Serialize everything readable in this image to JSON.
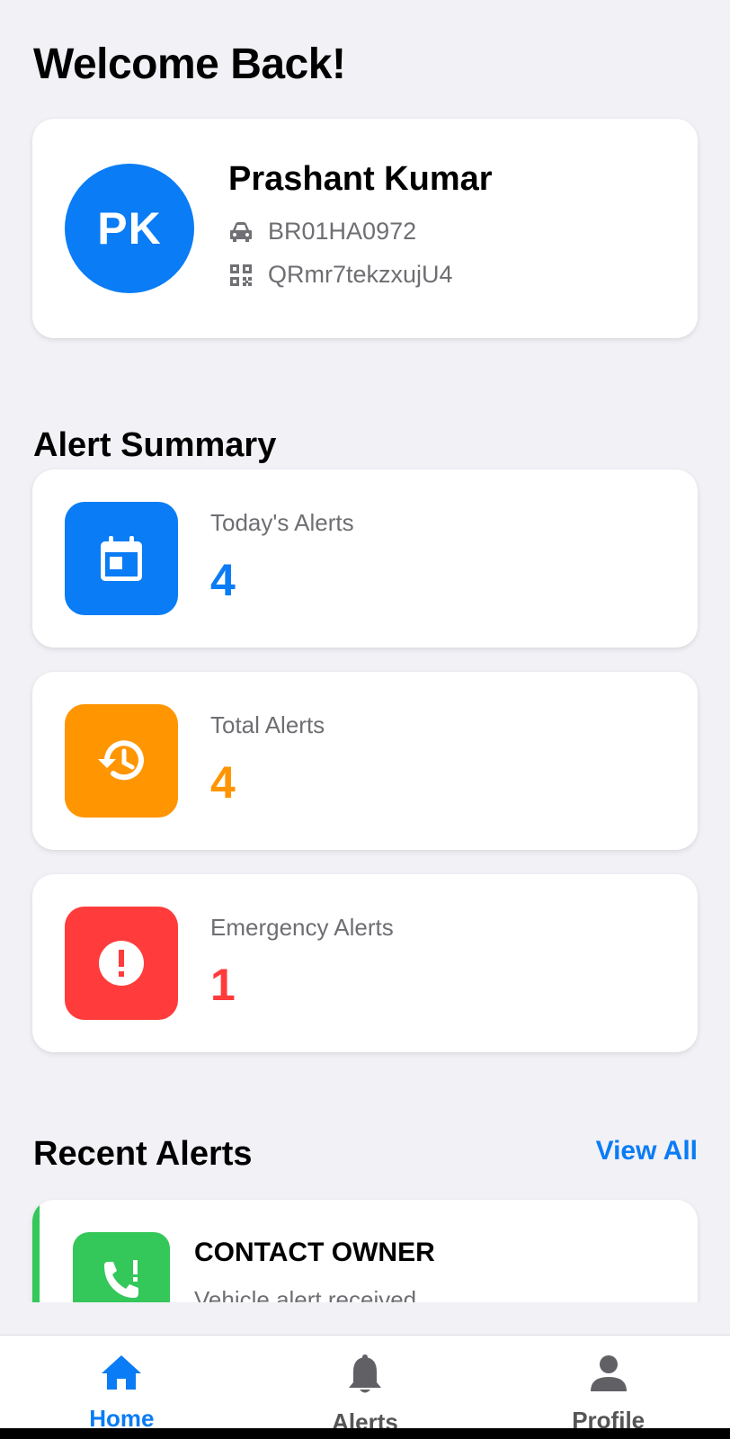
{
  "header": {
    "title": "Welcome Back!"
  },
  "profile": {
    "initials": "PK",
    "name": "Prashant Kumar",
    "vehicle_number": "BR01HA0972",
    "qr_code": "QRmr7tekzxujU4",
    "avatar_color": "#0a7cf5"
  },
  "alert_summary": {
    "title": "Alert Summary",
    "cards": [
      {
        "label": "Today's Alerts",
        "value": "4",
        "color": "#0a7cf5",
        "icon": "calendar-icon"
      },
      {
        "label": "Total Alerts",
        "value": "4",
        "color": "#ff9500",
        "icon": "history-icon"
      },
      {
        "label": "Emergency Alerts",
        "value": "1",
        "color": "#ff3b3b",
        "icon": "alert-circle-icon"
      }
    ]
  },
  "recent_alerts": {
    "title": "Recent Alerts",
    "view_all_label": "View All",
    "items": [
      {
        "title": "CONTACT OWNER",
        "subtitle": "Vehicle alert received",
        "color": "#34c759",
        "icon": "phone-alert-icon"
      }
    ]
  },
  "tabbar": {
    "tabs": [
      {
        "label": "Home",
        "icon": "home-icon",
        "active": true
      },
      {
        "label": "Alerts",
        "icon": "bell-icon",
        "active": false
      },
      {
        "label": "Profile",
        "icon": "person-icon",
        "active": false
      }
    ],
    "active_color": "#0a7cf5"
  }
}
